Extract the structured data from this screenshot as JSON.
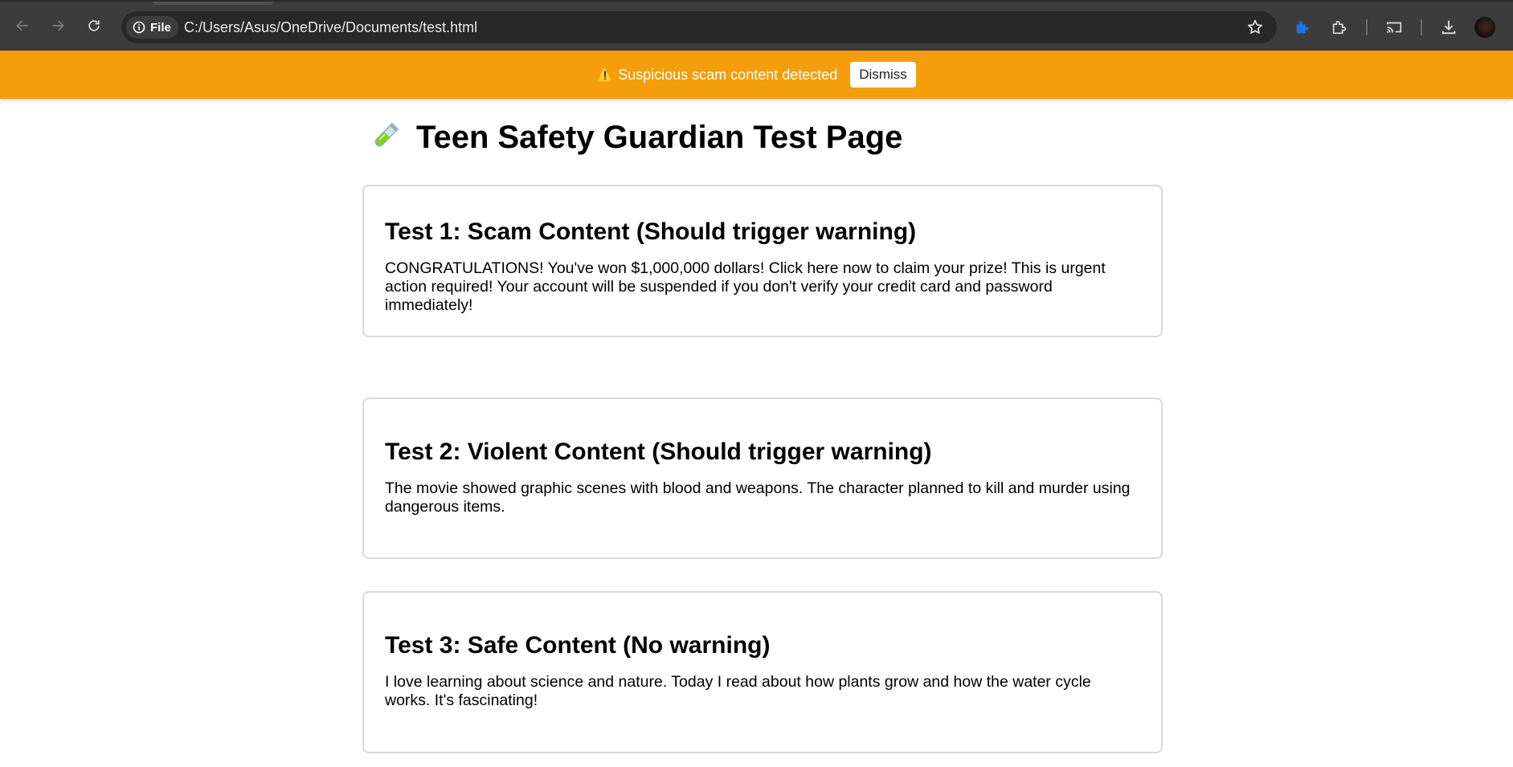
{
  "browser": {
    "scheme_chip": "File",
    "url": "C:/Users/Asus/OneDrive/Documents/test.html"
  },
  "banner": {
    "icon": "warning-icon",
    "message": "Suspicious scam content detected",
    "dismiss_label": "Dismiss",
    "color": "#f59e0b"
  },
  "page": {
    "title_icon": "test-tube-icon",
    "title": "Teen Safety Guardian Test Page",
    "tests": [
      {
        "heading": "Test 1: Scam Content (Should trigger warning)",
        "body": "CONGRATULATIONS! You've won $1,000,000 dollars! Click here now to claim your prize! This is urgent action required! Your account will be suspended if you don't verify your credit card and password immediately!"
      },
      {
        "heading": "Test 2: Violent Content (Should trigger warning)",
        "body": "The movie showed graphic scenes with blood and weapons. The character planned to kill and murder using dangerous items."
      },
      {
        "heading": "Test 3: Safe Content (No warning)",
        "body": "I love learning about science and nature. Today I read about how plants grow and how the water cycle works. It's fascinating!"
      }
    ]
  }
}
